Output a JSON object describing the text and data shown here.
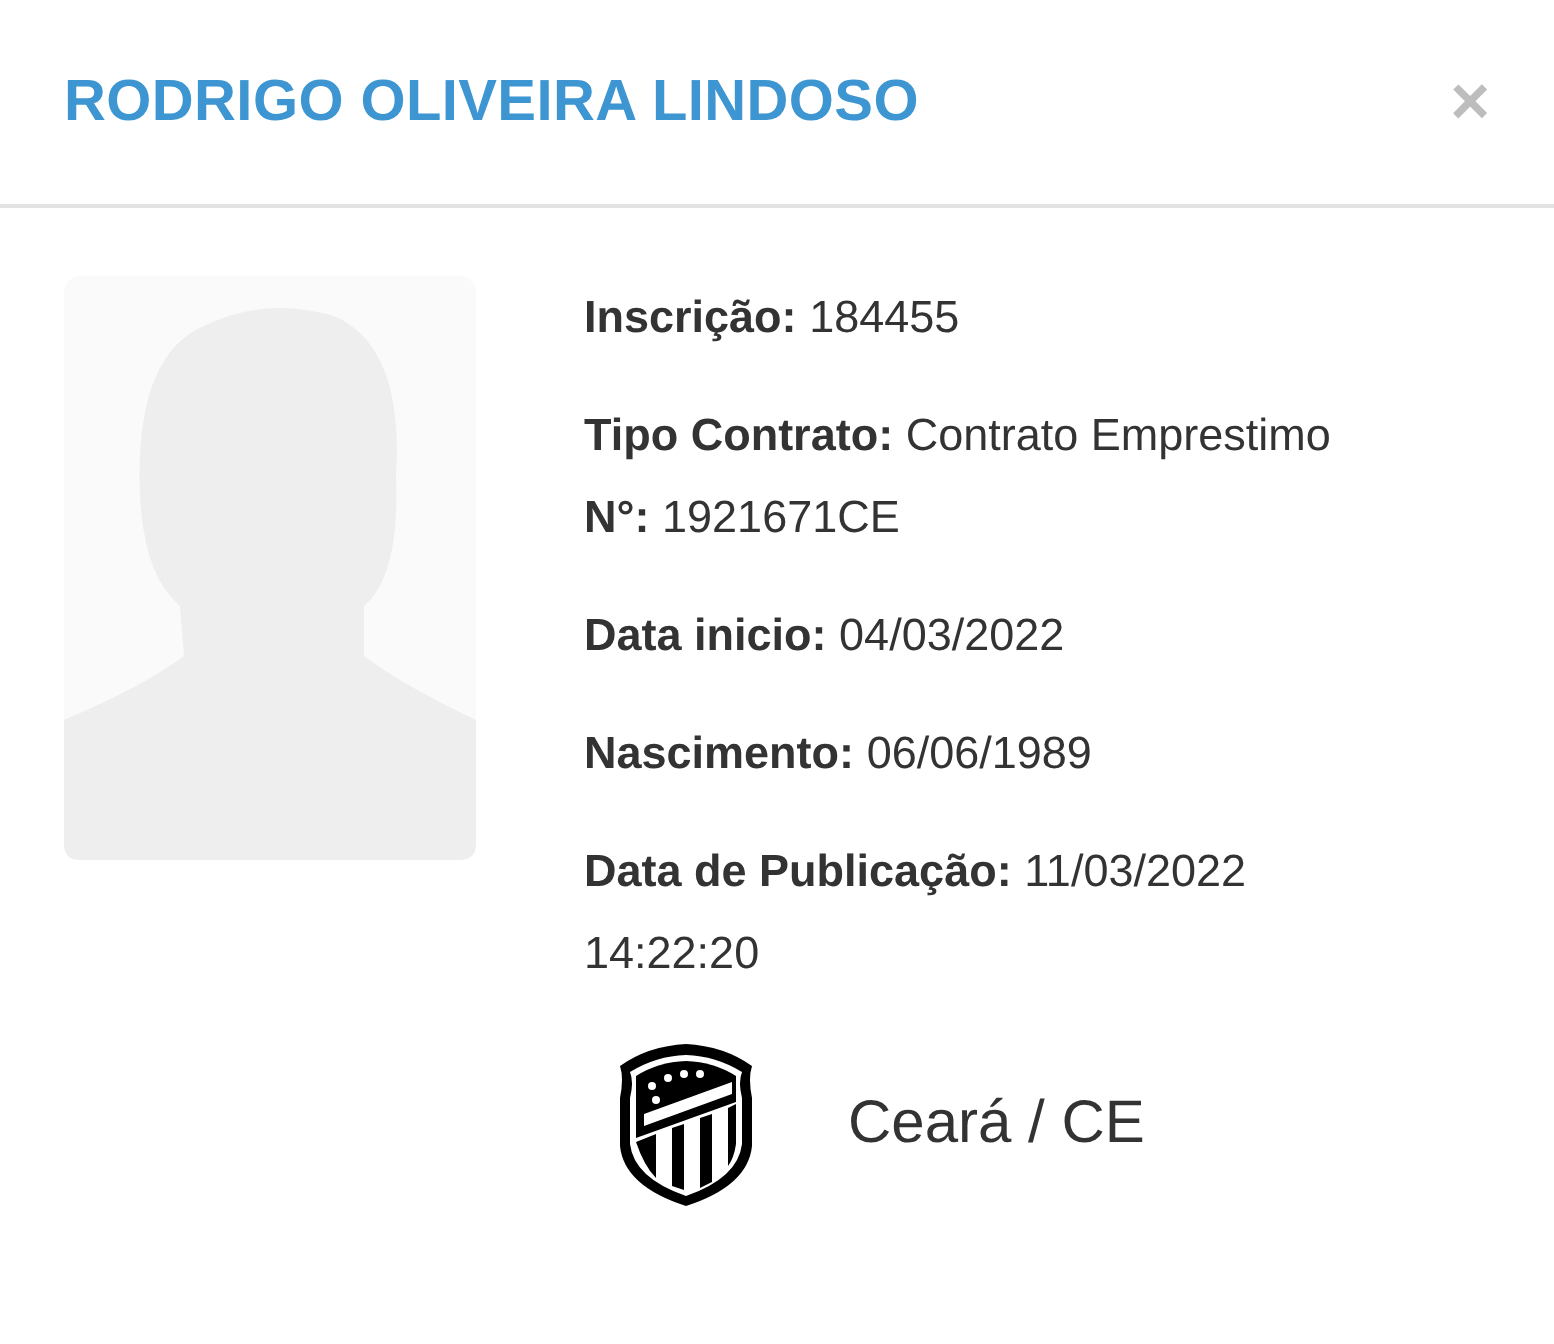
{
  "dialog": {
    "title": "RODRIGO OLIVEIRA LINDOSO",
    "close": "×"
  },
  "details": [
    {
      "label": "Inscrição:",
      "value": "184455"
    },
    {
      "label": "Tipo Contrato:",
      "value": "Contrato Emprestimo",
      "extra": {
        "label": "N°:",
        "value": "1921671CE"
      }
    },
    {
      "label": "Data inicio:",
      "value": "04/03/2022"
    },
    {
      "label": "Nascimento:",
      "value": "06/06/1989"
    },
    {
      "label": "Data de Publicação:",
      "value": "11/03/2022 14:22:20"
    }
  ],
  "club": {
    "name": "Ceará / CE"
  }
}
